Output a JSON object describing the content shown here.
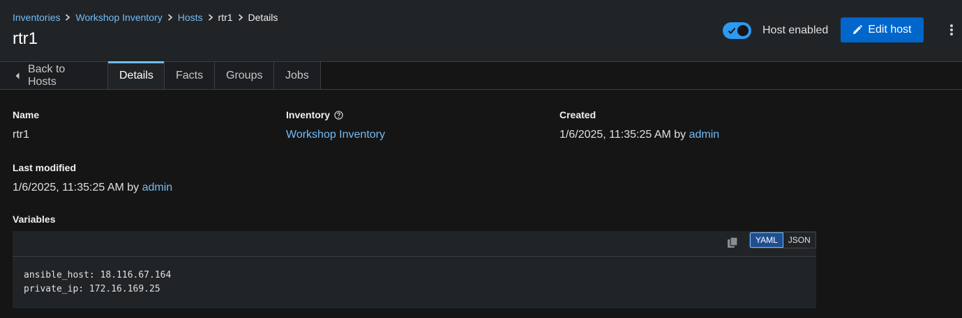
{
  "breadcrumb": [
    {
      "label": "Inventories",
      "link": true
    },
    {
      "label": "Workshop Inventory",
      "link": true
    },
    {
      "label": "Hosts",
      "link": true
    },
    {
      "label": "rtr1",
      "link": false
    },
    {
      "label": "Details",
      "link": false
    }
  ],
  "header": {
    "title": "rtr1",
    "toggle_label": "Host enabled",
    "toggle_state": "on",
    "edit_label": "Edit host"
  },
  "tabs": [
    {
      "label": "Back to Hosts"
    },
    {
      "label": "Details"
    },
    {
      "label": "Facts"
    },
    {
      "label": "Groups"
    },
    {
      "label": "Jobs"
    }
  ],
  "details": {
    "name_label": "Name",
    "name_value": "rtr1",
    "inventory_label": "Inventory",
    "inventory_value": "Workshop Inventory",
    "created_label": "Created",
    "created_date": "1/6/2025, 11:35:25 AM by ",
    "created_user": "admin",
    "modified_label": "Last modified",
    "modified_date": "1/6/2025, 11:35:25 AM by ",
    "modified_user": "admin"
  },
  "variables": {
    "label": "Variables",
    "modes": [
      "YAML",
      "JSON"
    ],
    "active_mode": "YAML",
    "lines": [
      "ansible_host: 18.116.67.164",
      "private_ip: 172.16.169.25"
    ]
  },
  "colors": {
    "accent": "#0066cc",
    "link": "#73bcf7",
    "toggle_on": "#2b9af3",
    "background": "#151515",
    "panel": "#212427"
  }
}
